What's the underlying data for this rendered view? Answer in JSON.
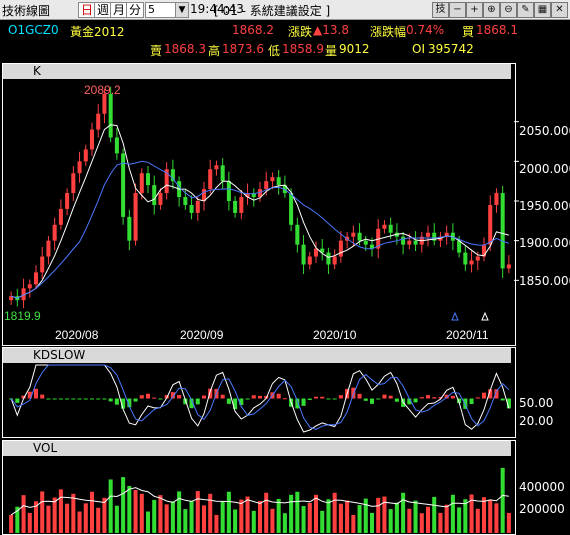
{
  "toolbar": {
    "app_title": "技術線圖",
    "timeframes": [
      {
        "label": "日",
        "selected": true
      },
      {
        "label": "週",
        "selected": false
      },
      {
        "label": "月",
        "selected": false
      },
      {
        "label": "分",
        "selected": false
      }
    ],
    "period_value": "5",
    "time": "19:44:43",
    "setting_label": "[ 01 - 系統建議設定 ]",
    "buttons": [
      "技",
      "−",
      "+",
      "⊕",
      "⊖",
      "✎",
      "▦",
      "✕"
    ]
  },
  "quote": {
    "code": "O1GCZ0",
    "name": "黃金2012",
    "last": "1868.2",
    "change_label": "漲跌",
    "change": "▲13.8",
    "pct_label": "漲跌幅",
    "pct": "0.74%",
    "bid_label": "買",
    "bid": "1868.1",
    "ask_label": "賣",
    "ask": "1868.3",
    "high_label": "高",
    "high": "1873.6",
    "low_label": "低",
    "low": "1858.9",
    "vol_label": "量",
    "vol": "9012",
    "oi_label": "OI",
    "oi": "395742"
  },
  "panels": {
    "k_label": "K",
    "kd_label": "KDSLOW",
    "vol_label": "VOL"
  },
  "colors": {
    "up": "#ff4040",
    "down": "#33dd33",
    "ma_short": "#ffffff",
    "ma_long": "#4a78ff",
    "kd_k": "#ffffff",
    "kd_d": "#4a78ff"
  },
  "chart_data": {
    "type": "candlestick",
    "price_axis_ticks": [
      "2050.000",
      "2000.000",
      "1950.000",
      "1900.000",
      "1850.000"
    ],
    "price_range": [
      1800,
      2100
    ],
    "date_labels": [
      "2020/08",
      "2020/09",
      "2020/10",
      "2020/11"
    ],
    "max_label": "2089.2",
    "min_label": "1819.9",
    "kd_axis_ticks": [
      "50.00",
      "20.00"
    ],
    "kd_range": [
      0,
      100
    ],
    "vol_axis_ticks": [
      "400000",
      "200000"
    ],
    "vol_range": [
      0,
      550000
    ],
    "close": [
      1830,
      1825,
      1840,
      1845,
      1860,
      1880,
      1900,
      1920,
      1940,
      1960,
      1985,
      2000,
      2015,
      2040,
      2060,
      2085,
      2030,
      2010,
      1930,
      1900,
      1960,
      1985,
      1970,
      1945,
      1960,
      1990,
      1975,
      1955,
      1945,
      1935,
      1950,
      1965,
      1990,
      1995,
      1975,
      1950,
      1935,
      1955,
      1960,
      1955,
      1965,
      1975,
      1980,
      1970,
      1960,
      1920,
      1895,
      1870,
      1880,
      1890,
      1885,
      1870,
      1880,
      1900,
      1905,
      1910,
      1900,
      1895,
      1890,
      1915,
      1920,
      1910,
      1905,
      1895,
      1900,
      1895,
      1905,
      1910,
      1900,
      1905,
      1910,
      1900,
      1885,
      1870,
      1875,
      1880,
      1895,
      1945,
      1960,
      1865,
      1870
    ]
  }
}
